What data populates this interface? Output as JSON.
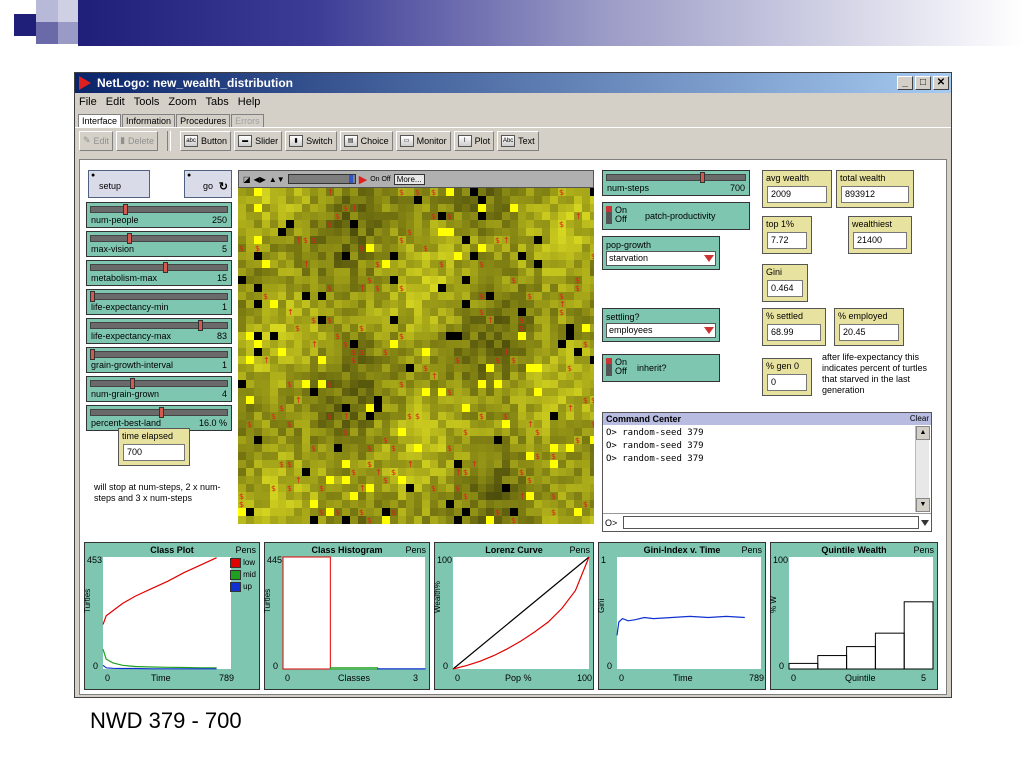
{
  "window": {
    "title": "NetLogo: new_wealth_distribution",
    "controls": [
      "_",
      "□",
      "✕"
    ]
  },
  "menu": [
    "File",
    "Edit",
    "Tools",
    "Zoom",
    "Tabs",
    "Help"
  ],
  "tabs": [
    {
      "label": "Interface",
      "active": true
    },
    {
      "label": "Information"
    },
    {
      "label": "Procedures"
    },
    {
      "label": "Errors",
      "disabled": true
    }
  ],
  "toolbar": {
    "edit": "Edit",
    "delete": "Delete",
    "button": "Button",
    "slider": "Slider",
    "switch": "Switch",
    "choice": "Choice",
    "monitor": "Monitor",
    "plot": "Plot",
    "text": "Text"
  },
  "buttons": {
    "setup": "setup",
    "go": "go"
  },
  "sliders": [
    {
      "label": "num-people",
      "value": "250",
      "fraction": 0.25
    },
    {
      "label": "max-vision",
      "value": "5",
      "fraction": 0.28
    },
    {
      "label": "metabolism-max",
      "value": "15",
      "fraction": 0.55
    },
    {
      "label": "life-expectancy-min",
      "value": "1",
      "fraction": 0.0
    },
    {
      "label": "life-expectancy-max",
      "value": "83",
      "fraction": 0.82
    },
    {
      "label": "grain-growth-interval",
      "value": "1",
      "fraction": 0.0
    },
    {
      "label": "num-grain-grown",
      "value": "4",
      "fraction": 0.3
    },
    {
      "label": "percent-best-land",
      "value": "16.0 %",
      "fraction": 0.52
    }
  ],
  "time_elapsed": {
    "label": "time elapsed",
    "value": "700"
  },
  "stop_note": "will stop at num-steps, 2 x num-steps and 3 x num-steps",
  "view": {
    "more": "More...",
    "on_off": "On Off"
  },
  "num_steps": {
    "label": "num-steps",
    "value": "700",
    "fraction": 0.7
  },
  "switches": {
    "patch_productivity": {
      "on": "On",
      "off": "Off",
      "label": "patch-productivity"
    },
    "inherit": {
      "on": "On",
      "off": "Off",
      "label": "inherit?"
    }
  },
  "choosers": {
    "pop_growth": {
      "label": "pop-growth",
      "value": "starvation"
    },
    "settling": {
      "label": "settling?",
      "value": "employees"
    }
  },
  "monitors": {
    "avg_wealth": {
      "label": "avg wealth",
      "value": "2009"
    },
    "total_wealth": {
      "label": "total wealth",
      "value": "893912"
    },
    "top1": {
      "label": "top 1%",
      "value": "7.72"
    },
    "wealthiest": {
      "label": "wealthiest",
      "value": "21400"
    },
    "gini": {
      "label": "Gini",
      "value": "0.464"
    },
    "settled": {
      "label": "% settled",
      "value": "68.99"
    },
    "employed": {
      "label": "% employed",
      "value": "20.45"
    },
    "gen0": {
      "label": "% gen 0",
      "value": "0"
    }
  },
  "gen_note": "after life-expectancy this indicates percent of turtles that starved in the last generation",
  "command_center": {
    "title": "Command Center",
    "clear": "Clear",
    "lines": [
      "O> random-seed 379",
      "O> random-seed 379",
      "O> random-seed 379"
    ],
    "prompt": "O>"
  },
  "colors": {
    "widget_green": "#7fc6b1",
    "monitor_yellow": "#e8e2a0",
    "view_base": "#8a8a20"
  },
  "chart_data": [
    {
      "type": "line",
      "title": "Class Plot",
      "pens_label": "Pens",
      "ylabel": "Turtles",
      "xlabel": "Time",
      "xlim": [
        0,
        789
      ],
      "ylim": [
        0,
        453
      ],
      "ytick_labels": [
        "453",
        "0"
      ],
      "xtick_labels": [
        "0",
        "789"
      ],
      "series": [
        {
          "name": "low",
          "color": "#e00000",
          "x": [
            0,
            20,
            60,
            120,
            200,
            300,
            400,
            500,
            600,
            700
          ],
          "values": [
            180,
            215,
            235,
            265,
            295,
            325,
            355,
            390,
            420,
            450
          ]
        },
        {
          "name": "mid",
          "color": "#20a020",
          "x": [
            0,
            20,
            60,
            120,
            200,
            300,
            400,
            500,
            600,
            700
          ],
          "values": [
            80,
            40,
            25,
            15,
            10,
            8,
            7,
            6,
            5,
            5
          ]
        },
        {
          "name": "up",
          "color": "#1030d0",
          "x": [
            0,
            20,
            60,
            120,
            200,
            300,
            400,
            500,
            600,
            700
          ],
          "values": [
            15,
            5,
            3,
            2,
            2,
            1,
            1,
            1,
            1,
            1
          ]
        }
      ]
    },
    {
      "type": "bar",
      "title": "Class Histogram",
      "pens_label": "Pens",
      "ylabel": "Turtles",
      "xlabel": "Classes",
      "xlim": [
        0,
        3
      ],
      "ylim": [
        0,
        445
      ],
      "ytick_labels": [
        "445",
        "0"
      ],
      "xtick_labels": [
        "0",
        "3"
      ],
      "categories": [
        "low",
        "mid",
        "up"
      ],
      "series": [
        {
          "name": "low",
          "color": "#e00000",
          "values": [
            445,
            0,
            0
          ]
        },
        {
          "name": "mid",
          "color": "#20a020",
          "values": [
            0,
            5,
            0
          ]
        },
        {
          "name": "up",
          "color": "#1030d0",
          "values": [
            0,
            0,
            1
          ]
        }
      ]
    },
    {
      "type": "line",
      "title": "Lorenz Curve",
      "pens_label": "Pens",
      "ylabel": "Wealth%",
      "xlabel": "Pop %",
      "xlim": [
        0,
        100
      ],
      "ylim": [
        0,
        100
      ],
      "ytick_labels": [
        "100",
        "0"
      ],
      "xtick_labels": [
        "0",
        "100"
      ],
      "series": [
        {
          "color": "#000000",
          "x": [
            0,
            100
          ],
          "values": [
            0,
            100
          ]
        },
        {
          "color": "#e00000",
          "x": [
            0,
            10,
            20,
            30,
            40,
            50,
            60,
            70,
            80,
            90,
            100
          ],
          "values": [
            0,
            3,
            7,
            12,
            18,
            25,
            33,
            42,
            54,
            70,
            100
          ]
        }
      ]
    },
    {
      "type": "line",
      "title": "Gini-Index v. Time",
      "pens_label": "Pens",
      "ylabel": "Gini",
      "xlabel": "Time",
      "xlim": [
        0,
        789
      ],
      "ylim": [
        0,
        1
      ],
      "ytick_labels": [
        "1",
        "0"
      ],
      "xtick_labels": [
        "0",
        "789"
      ],
      "series": [
        {
          "color": "#1030d0",
          "x": [
            0,
            10,
            30,
            60,
            100,
            150,
            200,
            300,
            400,
            500,
            600,
            700
          ],
          "values": [
            0.3,
            0.42,
            0.45,
            0.43,
            0.44,
            0.46,
            0.45,
            0.46,
            0.47,
            0.46,
            0.47,
            0.46
          ]
        }
      ]
    },
    {
      "type": "bar",
      "title": "Quintile Wealth",
      "pens_label": "Pens",
      "ylabel": "% W",
      "xlabel": "Quintile",
      "xlim": [
        0,
        5
      ],
      "ylim": [
        0,
        100
      ],
      "ytick_labels": [
        "100",
        "0"
      ],
      "xtick_labels": [
        "0",
        "5"
      ],
      "categories": [
        "1",
        "2",
        "3",
        "4",
        "5"
      ],
      "series": [
        {
          "color": "#000000",
          "values": [
            5,
            12,
            20,
            32,
            60
          ]
        }
      ]
    }
  ],
  "caption": "NWD 379 - 700"
}
